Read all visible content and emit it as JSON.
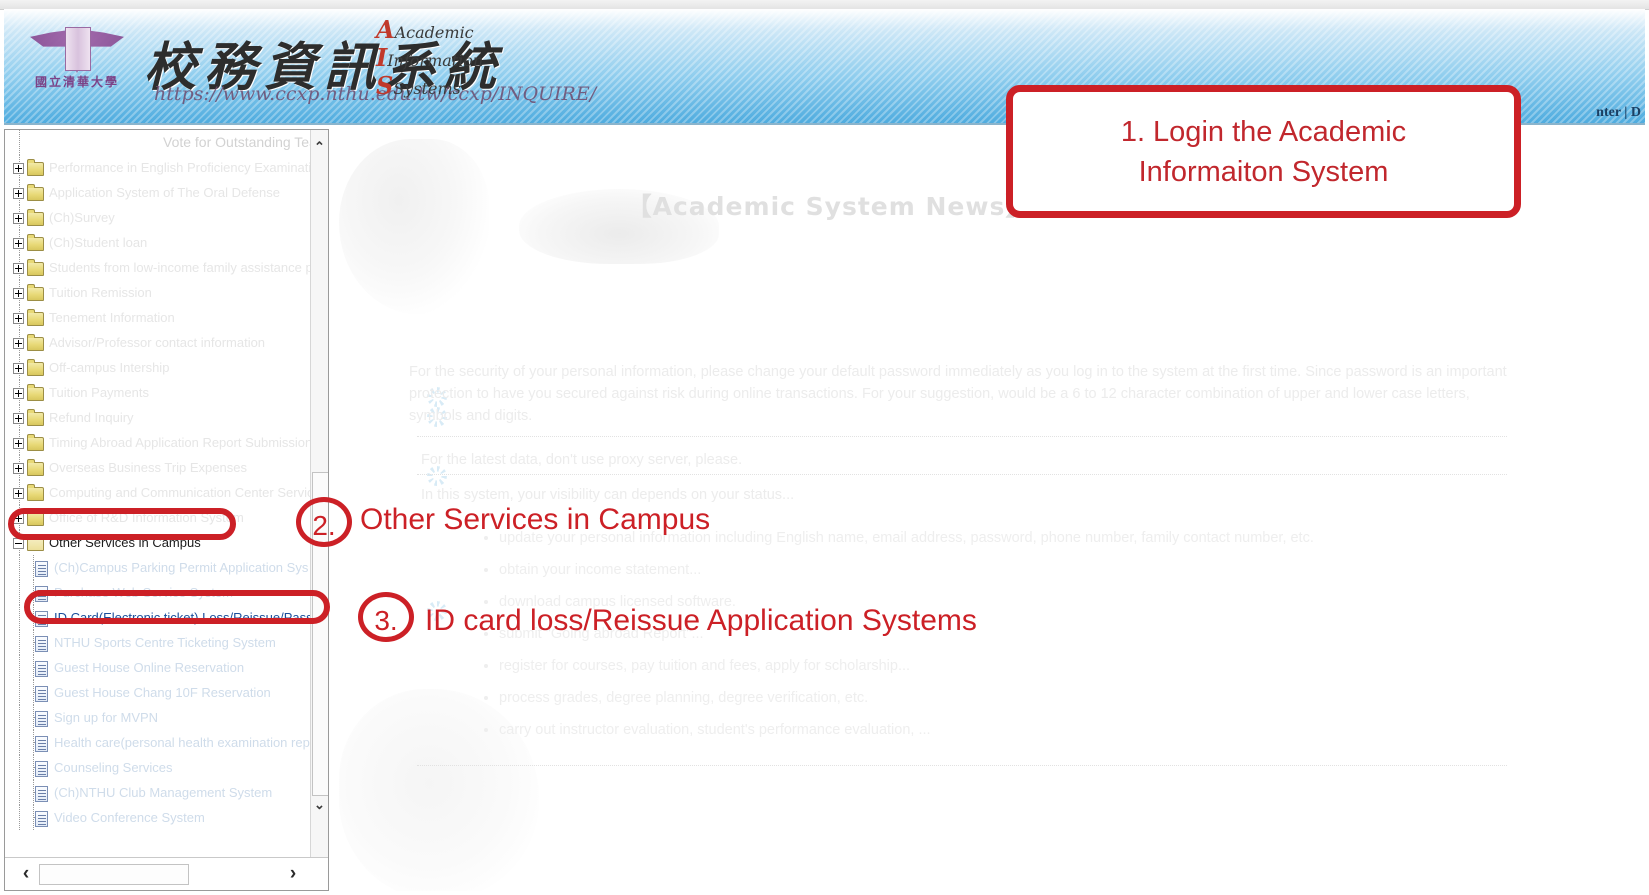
{
  "banner": {
    "crest_text": "國立清華大學",
    "system_title": "校務資訊系統",
    "url": "https://www.ccxp.nthu.edu.tw/ccxp/INQUIRE/",
    "ais_line1": "Academic",
    "ais_line2": "Information",
    "ais_line3": "Systems",
    "ais_cap1": "A",
    "ais_cap2": "I",
    "ais_cap3": "S",
    "nav_text": "nter | D"
  },
  "sidebar": {
    "cut_top_item": "Vote for Outstanding Teachers",
    "folders": [
      "Performance in English Proficiency Examination",
      "Application System of The Oral Defense",
      "(Ch)Survey",
      "(Ch)Student loan",
      "Students from low-income family assistance pr",
      "Tuition Remission",
      "Tenement Information",
      "Advisor/Professor contact information",
      "Off-campus Intership",
      "Tuition Payments",
      "Refund Inquiry",
      "Timing Abroad Application Report Submission",
      "Overseas Business Trip Expenses",
      "Computing and Communication Center Services",
      "Office of R&D Information System"
    ],
    "open_folder": "Other Services in Campus",
    "leaves": [
      "(Ch)Campus Parking Permit Application Sys",
      "Purchase Web Service System",
      "ID Card(Electronic ticket) Loss/Reissue/Pass",
      "NTHU Sports Centre Ticketing System",
      "Guest House Online Reservation",
      "Guest House Chang 10F Reservation",
      "Sign up for MVPN",
      "Health care(personal health examination repo",
      "Counseling Services",
      "(Ch)NTHU Club Management System",
      "Video Conference System"
    ],
    "highlighted_leaf_index": 2,
    "scroll_up_arrow": "⌃",
    "scroll_down_arrow": "⌄",
    "scroll_left_arrow": "‹",
    "scroll_right_arrow": "›"
  },
  "content": {
    "news_title": "【Academic System News】",
    "paragraph1": "For the security of your personal information, please change your default password immediately as you log in to the system at the first time. Since password is an important protection to have you secured against risk during online transactions. For your suggestion, would be a 6 to 12 character combination of upper and lower case letters, symbols and digits.",
    "paragraph2": "For the latest data, don't use proxy server, please.",
    "paragraph3": "In this system, your visibility can depends on your status...",
    "bullets": [
      "update your personal information including English name, email address, password, phone number, family contact number, etc.",
      "obtain your income statement...",
      "download campus licensed software.",
      "submit \"Going abroad Report\"...",
      "register for courses, pay tuition and fees, apply for scholarship...",
      "process grades, degree planning, degree verification, etc.",
      "carry out instructor evaluation, student's performance evaluation, ..."
    ]
  },
  "annotations": {
    "step1_text": "1. Login the Academic\nInformaiton System",
    "step2_number": "2.",
    "step2_text": "Other Services in Campus",
    "step3_number": "3.",
    "step3_text": "ID card loss/Reissue Application Systems",
    "accent_color": "#cc2026"
  }
}
